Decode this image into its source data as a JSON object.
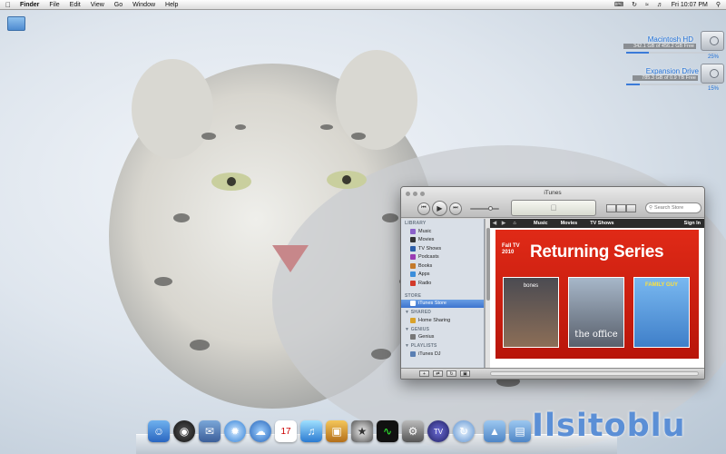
{
  "menubar": {
    "app_menu": "Finder",
    "menus": [
      "File",
      "Edit",
      "View",
      "Go",
      "Window",
      "Help"
    ],
    "clock": "Fri 10:07 PM"
  },
  "desktop": {
    "drives": [
      {
        "name": "Macintosh HD",
        "free": "342.1 GB of 456.2 GB Free",
        "percent_label": "25%",
        "used_fraction": 0.25
      },
      {
        "name": "Expansion Drive",
        "free": "785.3 GB of 0.9 TB Free",
        "percent_label": "15%",
        "used_fraction": 0.15
      }
    ]
  },
  "itunes": {
    "title": "iTunes",
    "search_placeholder": "Search Store",
    "sidebar": {
      "library_header": "LIBRARY",
      "library_items": [
        "Music",
        "Movies",
        "TV Shows",
        "Podcasts",
        "Books",
        "Apps",
        "Radio"
      ],
      "store_header": "STORE",
      "store_item": "iTunes Store",
      "shared_header": "SHARED",
      "shared_item": "Home Sharing",
      "genius_header": "GENIUS",
      "genius_item": "Genius",
      "playlists_header": "PLAYLISTS",
      "playlist_item": "iTunes DJ"
    },
    "store_nav": {
      "items": [
        "Music",
        "Movies",
        "TV Shows"
      ],
      "sign_in": "Sign In"
    },
    "banner": {
      "kicker": "Fall TV 2010",
      "title": "Returning Series",
      "posters": [
        "bones",
        "the office",
        "FAMILY GUY"
      ]
    }
  },
  "watermark": "Ilsitoblu",
  "colors": {
    "selection_blue": "#3d74cf",
    "banner_red": "#d42414",
    "drive_label_blue": "#1f6fd6"
  }
}
